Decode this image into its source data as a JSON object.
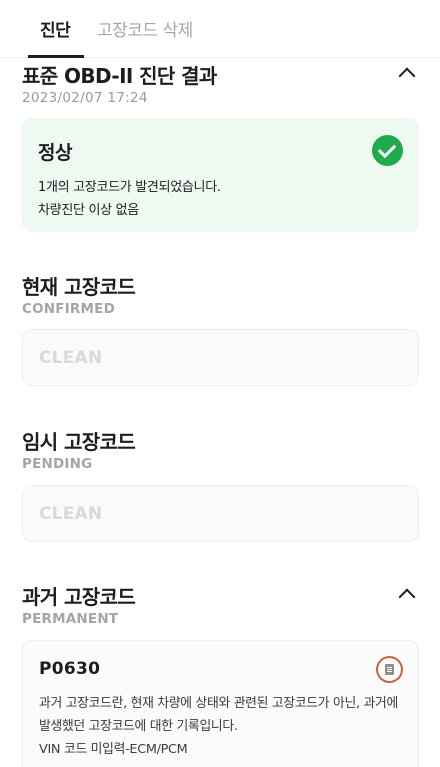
{
  "tabs": [
    {
      "label": "진단",
      "active": true
    },
    {
      "label": "고장코드 삭제",
      "active": false
    }
  ],
  "standard": {
    "title": "표준 OBD-II 진단 결과",
    "date": "2023/02/07 17:24",
    "status": {
      "title": "정상",
      "line1": "1개의 고장코드가 발견되었습니다.",
      "line2": "차량진단 이상 없음",
      "color": "#21a94d"
    }
  },
  "current": {
    "title": "현재 고장코드",
    "sub": "CONFIRMED",
    "value": "CLEAN"
  },
  "pending": {
    "title": "임시 고장코드",
    "sub": "PENDING",
    "value": "CLEAN"
  },
  "past": {
    "title": "과거 고장코드",
    "sub": "PERMANENT",
    "code": "P0630",
    "description": "과거 고장코드란, 현재 차량에 상태와 관련된 고장코드가 아닌, 과거에 발생했던 고장코드에 대한 기록입니다.",
    "detail": "VIN 코드 미입력-ECM/PCM"
  },
  "icons": {
    "collapse": "chevron-up-icon",
    "status": "check-circle-icon",
    "document": "document-icon"
  }
}
